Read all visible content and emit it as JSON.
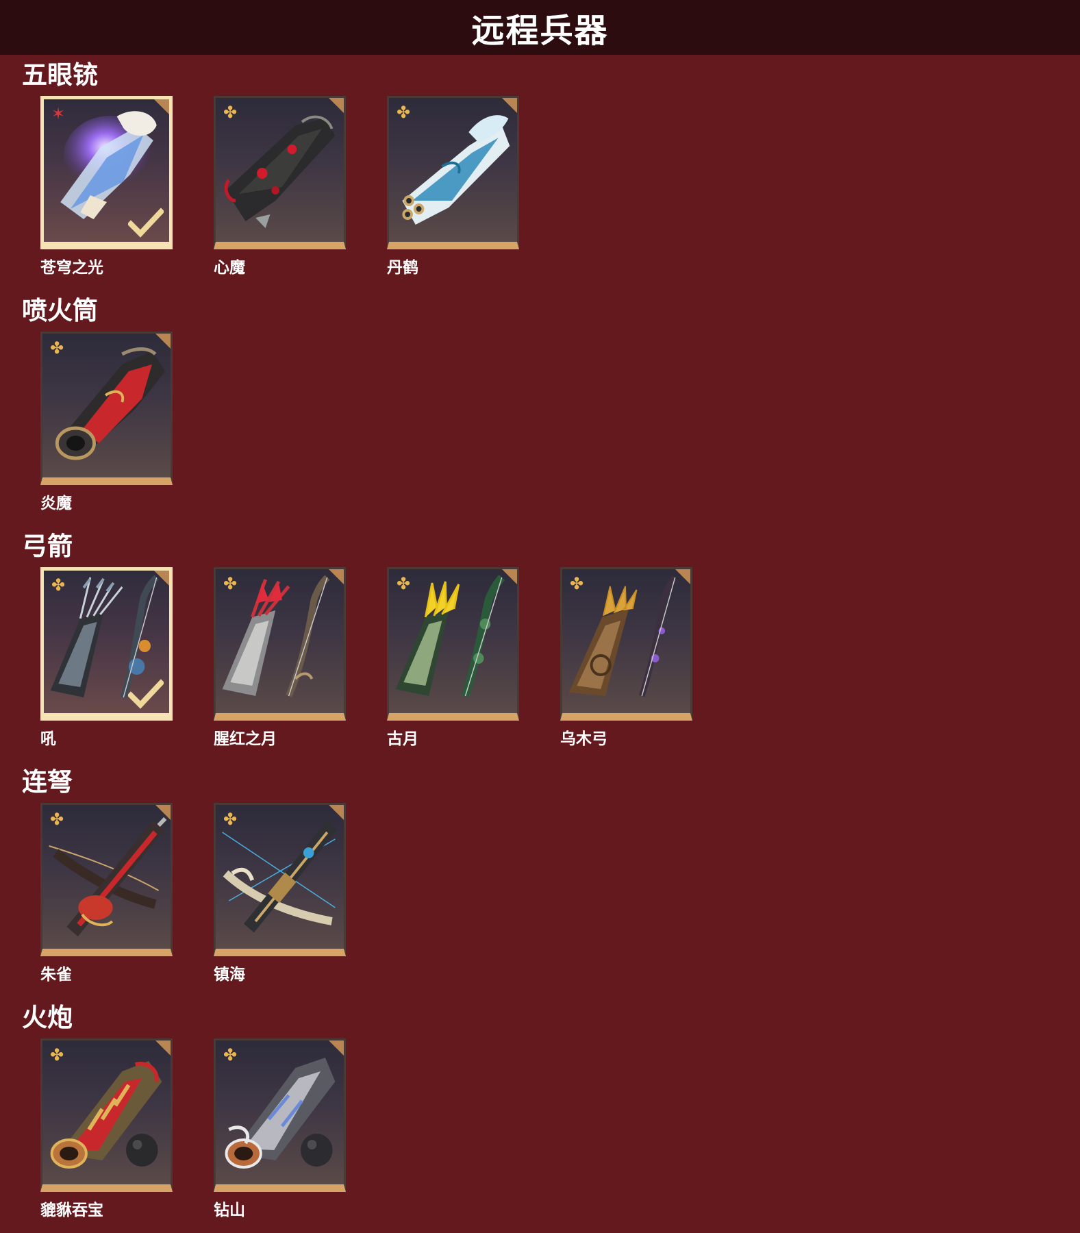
{
  "header": {
    "title": "远程兵器"
  },
  "colors": {
    "background": "#63191e",
    "header_bg": "#2c0c0e",
    "card_bottom": "#d7a468",
    "equipped_border": "#f6e4b5",
    "rarity_gold": "#e9b64f",
    "rarity_red": "#d8383c"
  },
  "sections": [
    {
      "title": "五眼铳",
      "items": [
        {
          "name": "苍穹之光",
          "rarity_icon": "red-star-icon",
          "equipped": true,
          "art": "purple-blue-gun"
        },
        {
          "name": "心魔",
          "rarity_icon": "gold-flower-icon",
          "equipped": false,
          "art": "dark-red-gun"
        },
        {
          "name": "丹鹤",
          "rarity_icon": "gold-flower-icon",
          "equipped": false,
          "art": "white-blue-gun"
        }
      ]
    },
    {
      "title": "喷火筒",
      "items": [
        {
          "name": "炎魔",
          "rarity_icon": "gold-flower-icon",
          "equipped": false,
          "art": "red-flamethrower"
        }
      ]
    },
    {
      "title": "弓箭",
      "items": [
        {
          "name": "吼",
          "rarity_icon": "gold-flower-icon",
          "equipped": true,
          "art": "blue-quiver-bow"
        },
        {
          "name": "腥红之月",
          "rarity_icon": "gold-flower-icon",
          "equipped": false,
          "art": "red-quiver-bow"
        },
        {
          "name": "古月",
          "rarity_icon": "gold-flower-icon",
          "equipped": false,
          "art": "green-quiver-bow"
        },
        {
          "name": "乌木弓",
          "rarity_icon": "gold-flower-icon",
          "equipped": false,
          "art": "wood-quiver-bow"
        }
      ]
    },
    {
      "title": "连弩",
      "items": [
        {
          "name": "朱雀",
          "rarity_icon": "gold-flower-icon",
          "equipped": false,
          "art": "red-crossbow"
        },
        {
          "name": "镇海",
          "rarity_icon": "gold-flower-icon",
          "equipped": false,
          "art": "blue-crossbow"
        }
      ]
    },
    {
      "title": "火炮",
      "items": [
        {
          "name": "貔貅吞宝",
          "rarity_icon": "gold-flower-icon",
          "equipped": false,
          "art": "red-cannon"
        },
        {
          "name": "钻山",
          "rarity_icon": "gold-flower-icon",
          "equipped": false,
          "art": "silver-cannon"
        }
      ]
    }
  ]
}
